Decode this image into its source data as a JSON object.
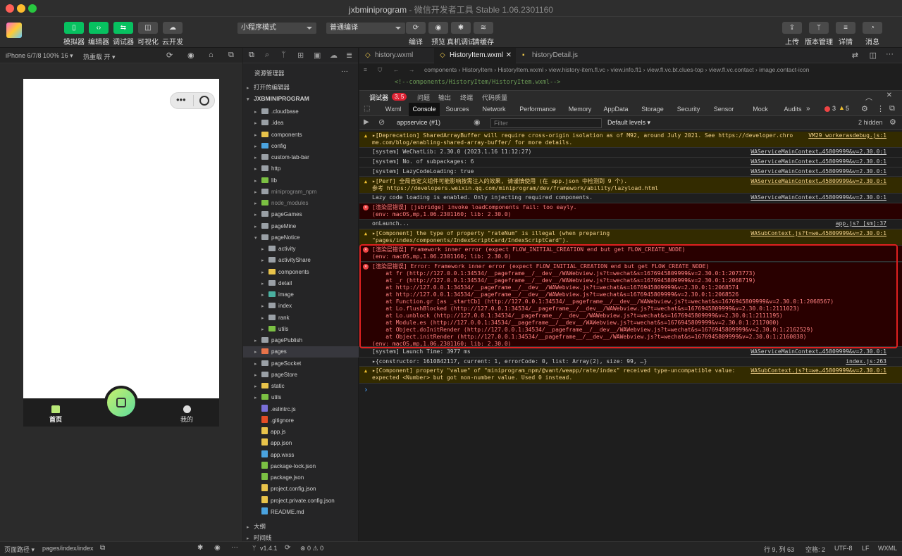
{
  "window": {
    "title": "jxbminiprogram",
    "subtitle": " - 微信开发者工具 Stable 1.06.2301160",
    "traffic": [
      "#fe5f57",
      "#febc2e",
      "#28c840"
    ]
  },
  "toolbar": {
    "left": [
      {
        "icon": "phone-icon",
        "label": "模拟器"
      },
      {
        "icon": "code-icon",
        "label": "编辑器"
      },
      {
        "icon": "debug-icon",
        "label": "调试器"
      },
      {
        "icon": "visual-icon",
        "label": "可视化"
      },
      {
        "icon": "cloud-icon",
        "label": "云开发"
      }
    ],
    "mode_select": "小程序模式",
    "compile_select": "普通编译",
    "mid": [
      {
        "icon": "refresh-icon",
        "label": "编译"
      },
      {
        "icon": "eye-icon",
        "label": "预览"
      },
      {
        "icon": "bug-icon",
        "label": "真机调试"
      },
      {
        "icon": "layers-icon",
        "label": "清缓存"
      }
    ],
    "right": [
      {
        "icon": "upload-icon",
        "label": "上传"
      },
      {
        "icon": "branch-icon",
        "label": "版本管理"
      },
      {
        "icon": "menu-icon",
        "label": "详情"
      },
      {
        "icon": "bell-icon",
        "label": "消息"
      }
    ]
  },
  "simulator": {
    "device": "iPhone 6/7/8 100% 16 ▾",
    "hotreload": "热重载 开 ▾",
    "tabs": [
      {
        "label": "首页",
        "active": true
      },
      {
        "label": "我的",
        "active": false
      }
    ],
    "capsule": "•••"
  },
  "explorer": {
    "title": "资源管理器",
    "more": "···",
    "open_editors": "打开的编辑器",
    "project": "JXBMINIPROGRAM",
    "items": [
      {
        "name": ".cloudbase",
        "kind": "folder",
        "depth": 1,
        "color": "#9aa0a6",
        "arrow": "▸"
      },
      {
        "name": ".idea",
        "kind": "folder",
        "depth": 1,
        "color": "#9aa0a6",
        "arrow": "▸"
      },
      {
        "name": "components",
        "kind": "folder",
        "depth": 1,
        "color": "#e8c34a",
        "arrow": "▸"
      },
      {
        "name": "config",
        "kind": "folder",
        "depth": 1,
        "color": "#4aa3df",
        "arrow": "▸"
      },
      {
        "name": "custom-tab-bar",
        "kind": "folder",
        "depth": 1,
        "color": "#9aa0a6",
        "arrow": "▸"
      },
      {
        "name": "http",
        "kind": "folder",
        "depth": 1,
        "color": "#9aa0a6",
        "arrow": "▸"
      },
      {
        "name": "lib",
        "kind": "folder",
        "depth": 1,
        "color": "#7bc043",
        "arrow": "▸"
      },
      {
        "name": "miniprogram_npm",
        "kind": "folder",
        "depth": 1,
        "color": "#9aa0a6",
        "arrow": "▸",
        "dim": true
      },
      {
        "name": "node_modules",
        "kind": "folder",
        "depth": 1,
        "color": "#7bc043",
        "arrow": "▸",
        "dim": true
      },
      {
        "name": "pageGames",
        "kind": "folder",
        "depth": 1,
        "color": "#9aa0a6",
        "arrow": "▸"
      },
      {
        "name": "pageMine",
        "kind": "folder",
        "depth": 1,
        "color": "#9aa0a6",
        "arrow": "▸"
      },
      {
        "name": "pageNotice",
        "kind": "folder",
        "depth": 1,
        "color": "#9aa0a6",
        "arrow": "▾"
      },
      {
        "name": "activity",
        "kind": "folder",
        "depth": 2,
        "color": "#9aa0a6",
        "arrow": "▸"
      },
      {
        "name": "activityShare",
        "kind": "folder",
        "depth": 2,
        "color": "#9aa0a6",
        "arrow": "▸"
      },
      {
        "name": "components",
        "kind": "folder",
        "depth": 2,
        "color": "#e8c34a",
        "arrow": "▸"
      },
      {
        "name": "detail",
        "kind": "folder",
        "depth": 2,
        "color": "#9aa0a6",
        "arrow": "▸"
      },
      {
        "name": "image",
        "kind": "folder",
        "depth": 2,
        "color": "#4ab0a0",
        "arrow": "▸"
      },
      {
        "name": "index",
        "kind": "folder",
        "depth": 2,
        "color": "#9aa0a6",
        "arrow": "▸"
      },
      {
        "name": "rank",
        "kind": "folder",
        "depth": 2,
        "color": "#9aa0a6",
        "arrow": "▸"
      },
      {
        "name": "utils",
        "kind": "folder",
        "depth": 2,
        "color": "#7bc043",
        "arrow": "▸"
      },
      {
        "name": "pagePublish",
        "kind": "folder",
        "depth": 1,
        "color": "#9aa0a6",
        "arrow": "▸"
      },
      {
        "name": "pages",
        "kind": "folder",
        "depth": 1,
        "color": "#e8734a",
        "arrow": "▸",
        "selected": true
      },
      {
        "name": "pageSocket",
        "kind": "folder",
        "depth": 1,
        "color": "#9aa0a6",
        "arrow": "▸"
      },
      {
        "name": "pageStore",
        "kind": "folder",
        "depth": 1,
        "color": "#9aa0a6",
        "arrow": "▸"
      },
      {
        "name": "static",
        "kind": "folder",
        "depth": 1,
        "color": "#e8c34a",
        "arrow": "▸"
      },
      {
        "name": "utils",
        "kind": "folder",
        "depth": 1,
        "color": "#7bc043",
        "arrow": "▸"
      },
      {
        "name": ".eslintrc.js",
        "kind": "file",
        "depth": 1,
        "color": "#7a6fd6"
      },
      {
        "name": ".gitignore",
        "kind": "file",
        "depth": 1,
        "color": "#e44d26"
      },
      {
        "name": "app.js",
        "kind": "file",
        "depth": 1,
        "color": "#e8c34a"
      },
      {
        "name": "app.json",
        "kind": "file",
        "depth": 1,
        "color": "#e8c34a"
      },
      {
        "name": "app.wxss",
        "kind": "file",
        "depth": 1,
        "color": "#4aa3df"
      },
      {
        "name": "package-lock.json",
        "kind": "file",
        "depth": 1,
        "color": "#7bc043"
      },
      {
        "name": "package.json",
        "kind": "file",
        "depth": 1,
        "color": "#7bc043"
      },
      {
        "name": "project.config.json",
        "kind": "file",
        "depth": 1,
        "color": "#e8c34a"
      },
      {
        "name": "project.private.config.json",
        "kind": "file",
        "depth": 1,
        "color": "#e8c34a"
      },
      {
        "name": "README.md",
        "kind": "file",
        "depth": 1,
        "color": "#4aa3df"
      }
    ],
    "outline": "大纲",
    "timeline": "时间线"
  },
  "editor": {
    "tabs": [
      {
        "label": "history.wxml",
        "active": false
      },
      {
        "label": "HistoryItem.wxml",
        "active": true,
        "close": "✕"
      },
      {
        "label": "historyDetail.js",
        "active": false
      }
    ],
    "breadcrumb": "components  ›  HistoryItem  ›  HistoryItem.wxml  ›  view.history-item.fl.vc  ›  view.info.fl1  ›  view.fl.vc.bt.clues-top  ›  view.fl.vc.contact  ›  image.contact-icon",
    "code": "<!--components/HistoryItem/HistoryItem.wxml-->"
  },
  "debug": {
    "tabs": [
      "调试器",
      "问题",
      "输出",
      "终端",
      "代码质量"
    ],
    "badge": "3, 5",
    "devtools": [
      "Wxml",
      "Console",
      "Sources",
      "Network",
      "Performance",
      "Memory",
      "AppData",
      "Storage",
      "Security",
      "Sensor",
      "Mock",
      "Audits"
    ],
    "more": "»",
    "counts": {
      "err": "3",
      "warn": "5"
    },
    "context": "appservice (#1)",
    "filter_placeholder": "Filter",
    "levels": "Default levels ▾",
    "hidden": "2 hidden"
  },
  "console": [
    {
      "type": "warn",
      "lines": [
        "▸[Deprecation] SharedArrayBuffer will require cross-origin isolation as of M92, around July 2021. See https://developer.chro",
        "me.com/blog/enabling-shared-array-buffer/ for more details."
      ],
      "src": "VM29 workerasdebug.js:1"
    },
    {
      "type": "info",
      "lines": [
        "[system] WeChatLib: 2.30.0 (2023.1.16 11:12:27)"
      ],
      "src": "WAServiceMainContext…45809999&v=2.30.0:1"
    },
    {
      "type": "info",
      "lines": [
        "[system] No. of subpackages: 6"
      ],
      "src": "WAServiceMainContext…45809999&v=2.30.0:1"
    },
    {
      "type": "info",
      "lines": [
        "[system] LazyCodeLoading: true"
      ],
      "src": "WAServiceMainContext…45809999&v=2.30.0:1"
    },
    {
      "type": "warn",
      "lines": [
        "▸[Perf] 全局自定义组件可能影响按需注入的效果, 请谨慎使用 (在 app.json 中检测到 9 个).",
        "参考 https://developers.weixin.qq.com/miniprogram/dev/framework/ability/lazyload.html"
      ],
      "src": "WAServiceMainContext…45809999&v=2.30.0:1"
    },
    {
      "type": "info",
      "lines": [
        "Lazy code loading is enabled. Only injecting required components."
      ],
      "src": "WAServiceMainContext…45809999&v=2.30.0:1"
    },
    {
      "type": "err",
      "lines": [
        "[渲染层错误] [jsbridge] invoke loadComponents fail: too eayly.",
        "(env: macOS,mp,1.06.2301160; lib: 2.30.0)"
      ],
      "src": ""
    },
    {
      "type": "info",
      "lines": [
        "onLaunch..."
      ],
      "src": "app.js? [sm]:37"
    },
    {
      "type": "warn",
      "lines": [
        "▸[Component] the type of property \"rateNum\" is illegal (when preparing",
        "\"pages/index/components/IndexScriptCard/IndexScriptCard\")."
      ],
      "src": "WASubContext.js?t=we…45809999&v=2.30.0:1"
    },
    {
      "type": "err",
      "lines": [
        "[渲染层错误] Framework inner error (expect FLOW_INITIAL_CREATION end but get FLOW_CREATE_NODE)",
        "(env: macOS,mp,1.06.2301160; lib: 2.30.0)"
      ],
      "src": ""
    },
    {
      "type": "err",
      "lines": [
        "[渲染层错误] Error: Framework inner error (expect FLOW_INITIAL_CREATION end but get FLOW_CREATE_NODE)",
        "    at fr (http://127.0.0.1:34534/__pageframe__/__dev__/WAWebview.js?t=wechat&s=1676945809999&v=2.30.0:1:2073773)",
        "    at _r (http://127.0.0.1:34534/__pageframe__/__dev__/WAWebview.js?t=wechat&s=1676945809999&v=2.30.0:1:2068719)",
        "    at http://127.0.0.1:34534/__pageframe__/__dev__/WAWebview.js?t=wechat&s=1676945809999&v=2.30.0:1:2068574",
        "    at http://127.0.0.1:34534/__pageframe__/__dev__/WAWebview.js?t=wechat&s=1676945809999&v=2.30.0:1:2068526",
        "    at Function.gr [as _startCb] (http://127.0.0.1:34534/__pageframe__/__dev__/WAWebview.js?t=wechat&s=1676945809999&v=2.30.0:1:2068567)",
        "    at Lo.flushBlocked (http://127.0.0.1:34534/__pageframe__/__dev__/WAWebview.js?t=wechat&s=1676945809999&v=2.30.0:1:2111023)",
        "    at Lo.unblock (http://127.0.0.1:34534/__pageframe__/__dev__/WAWebview.js?t=wechat&s=1676945809999&v=2.30.0:1:2111195)",
        "    at Module.es (http://127.0.0.1:34534/__pageframe__/__dev__/WAWebview.js?t=wechat&s=1676945809999&v=2.30.0:1:2117000)",
        "    at Object.doInitRender (http://127.0.0.1:34534/__pageframe__/__dev__/WAWebview.js?t=wechat&s=1676945809999&v=2.30.0:1:2162529)",
        "    at Object.initRender (http://127.0.0.1:34534/__pageframe__/__dev__/WAWebview.js?t=wechat&s=1676945809999&v=2.30.0:1:2160038)",
        "(env: macOS,mp,1.06.2301160; lib: 2.30.0)"
      ],
      "src": ""
    },
    {
      "type": "info",
      "lines": [
        "[system] Launch Time: 3977 ms"
      ],
      "src": "WAServiceMainContext…45809999&v=2.30.0:1"
    },
    {
      "type": "info",
      "lines": [
        "▸{constructor: 1610842117, current: 1, errorCode: 0, list: Array(2), size: 99, …}"
      ],
      "src": "index.js:263"
    },
    {
      "type": "warn",
      "lines": [
        "▸[Component] property \"value\" of \"miniprogram_npm/@vant/weapp/rate/index\" received type-uncompatible value:",
        "expected <Number> but got non-number value. Used 0 instead."
      ],
      "src": "WASubContext.js?t=we…45809999&v=2.30.0:1"
    }
  ],
  "prompt": "›",
  "highlight_color": "#e02020",
  "statusbar": {
    "path_label": "页面路径 ▾",
    "path": "pages/index/index",
    "branch": "v1.4.1",
    "problems": "⊗ 0 ⚠ 0",
    "cursor": "行 9, 列 63",
    "spaces": "空格: 2",
    "encoding": "UTF-8",
    "eol": "LF",
    "lang": "WXML"
  }
}
